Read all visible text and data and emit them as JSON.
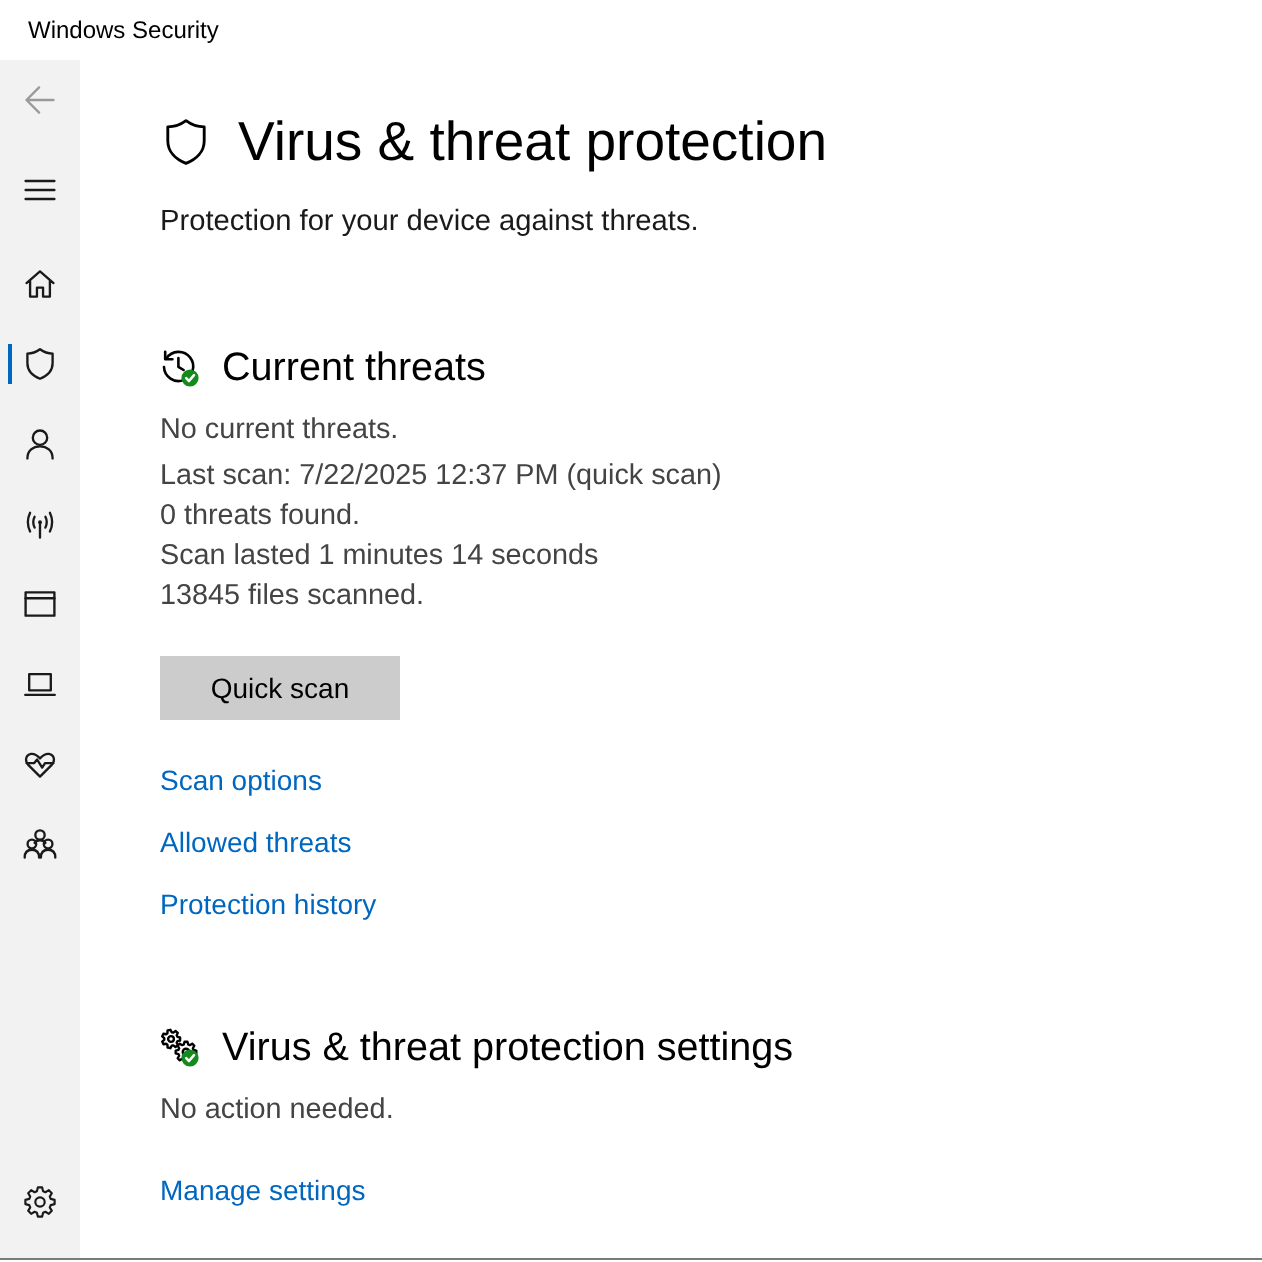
{
  "window": {
    "title": "Windows Security"
  },
  "sidebar": {
    "back": {
      "disabled": true
    },
    "items": [
      {
        "kind": "home",
        "selected": false
      },
      {
        "kind": "shield",
        "selected": true
      },
      {
        "kind": "account",
        "selected": false
      },
      {
        "kind": "network",
        "selected": false
      },
      {
        "kind": "browser",
        "selected": false
      },
      {
        "kind": "device",
        "selected": false
      },
      {
        "kind": "health",
        "selected": false
      },
      {
        "kind": "family",
        "selected": false
      }
    ],
    "footer_items": [
      {
        "kind": "settings",
        "selected": false
      }
    ]
  },
  "page": {
    "title": "Virus & threat protection",
    "subtitle": "Protection for your device against threats."
  },
  "sections": [
    {
      "kind": "threats",
      "healthy": true,
      "title": "Current threats",
      "status": "No current threats.",
      "details": [
        "Last scan: 7/22/2025 12:37 PM (quick scan)",
        "0 threats found.",
        "Scan lasted 1 minutes 14 seconds",
        "13845 files scanned."
      ],
      "button": "Quick scan",
      "links": [
        "Scan options",
        "Allowed threats",
        "Protection history"
      ]
    },
    {
      "kind": "settings",
      "healthy": true,
      "title": "Virus & threat protection settings",
      "status": "No action needed.",
      "links": [
        "Manage settings"
      ]
    }
  ]
}
